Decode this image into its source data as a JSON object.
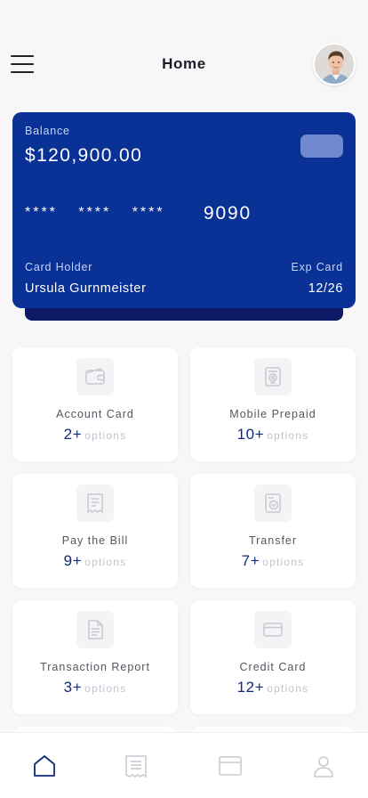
{
  "header": {
    "title": "Home",
    "menu_icon": "hamburger-menu-icon",
    "avatar": "user-avatar"
  },
  "card": {
    "balance_label": "Balance",
    "balance_value": "$120,900.00",
    "masked_digits": "**** **** ****",
    "last_four": "9090",
    "holder_label": "Card Holder",
    "holder_name": "Ursula Gurnmeister",
    "exp_label": "Exp Card",
    "exp_value": "12/26",
    "colors": {
      "card": "#0a3196",
      "card_shadow": "#0c1a66",
      "chip": "#6f88d0"
    }
  },
  "services": [
    {
      "label": "Account Card",
      "count": "2+",
      "unit": "options",
      "icon": "wallet-icon"
    },
    {
      "label": "Mobile Prepaid",
      "count": "10+",
      "unit": "options",
      "icon": "mobile-prepaid-icon"
    },
    {
      "label": "Pay the Bill",
      "count": "9+",
      "unit": "options",
      "icon": "bill-icon"
    },
    {
      "label": "Transfer",
      "count": "7+",
      "unit": "options",
      "icon": "transfer-icon"
    },
    {
      "label": "Transaction Report",
      "count": "3+",
      "unit": "options",
      "icon": "report-icon"
    },
    {
      "label": "Credit Card",
      "count": "12+",
      "unit": "options",
      "icon": "credit-card-icon"
    }
  ],
  "bottom_nav": [
    {
      "name": "home",
      "icon": "home-icon",
      "active": true
    },
    {
      "name": "receipt",
      "icon": "receipt-icon",
      "active": false
    },
    {
      "name": "card",
      "icon": "card-icon",
      "active": false
    },
    {
      "name": "profile",
      "icon": "profile-icon",
      "active": false
    }
  ],
  "colors": {
    "accent": "#102a7a",
    "muted": "#c2c4cc",
    "background": "#f7f7f8"
  }
}
